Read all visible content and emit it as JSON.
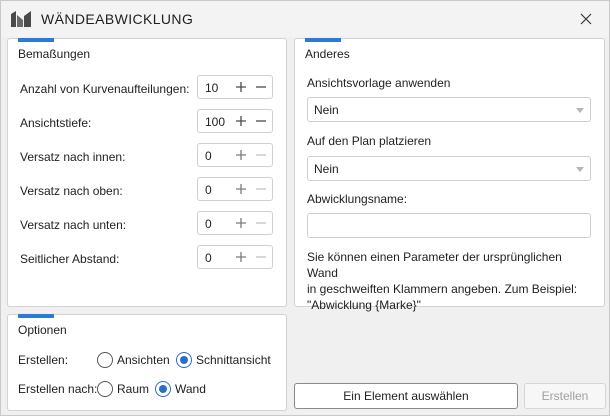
{
  "window": {
    "title": "WÄNDEABWICKLUNG",
    "accent": "#2b7bd6"
  },
  "dimensions": {
    "title": "Bemaßungen",
    "rows": [
      {
        "label": "Anzahl von Kurvenaufteilungen:",
        "value": "10",
        "minus_enabled": true
      },
      {
        "label": "Ansichtstiefe:",
        "value": "100",
        "minus_enabled": true
      },
      {
        "label": "Versatz nach innen:",
        "value": "0",
        "minus_enabled": false
      },
      {
        "label": "Versatz nach oben:",
        "value": "0",
        "minus_enabled": false
      },
      {
        "label": "Versatz nach unten:",
        "value": "0",
        "minus_enabled": false
      },
      {
        "label": "Seitlicher Abstand:",
        "value": "0",
        "minus_enabled": false
      }
    ]
  },
  "other": {
    "title": "Anderes",
    "view_template_label": "Ansichtsvorlage anwenden",
    "view_template_value": "Nein",
    "place_on_sheet_label": "Auf den Plan platzieren",
    "place_on_sheet_value": "Nein",
    "name_label": "Abwicklungsname:",
    "name_value": "",
    "info_lines": [
      "Sie können einen Parameter der ursprünglichen Wand",
      "in geschweiften Klammern angeben. Zum Beispiel:",
      "\"Abwicklung {Marke}\""
    ]
  },
  "options": {
    "title": "Optionen",
    "create_label": "Erstellen:",
    "create_options": [
      {
        "label": "Ansichten",
        "selected": false
      },
      {
        "label": "Schnittansicht",
        "selected": true
      }
    ],
    "create_by_label": "Erstellen nach:",
    "create_by_options": [
      {
        "label": "Raum",
        "selected": false
      },
      {
        "label": "Wand",
        "selected": true
      }
    ]
  },
  "buttons": {
    "select_element": "Ein Element auswählen",
    "create": "Erstellen"
  }
}
